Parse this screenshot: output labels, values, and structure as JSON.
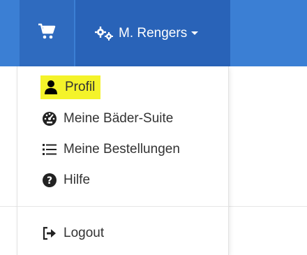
{
  "navbar": {
    "cart_icon": "shopping-cart-icon",
    "user_icon": "gears-icon",
    "user_name": "M. Rengers",
    "accent_color": "#3b7fd4"
  },
  "menu": {
    "items": [
      {
        "label": "Profil",
        "icon": "user-icon",
        "highlighted": true
      },
      {
        "label": "Meine Bäder-Suite",
        "icon": "tachometer-icon"
      },
      {
        "label": "Meine Bestellungen",
        "icon": "list-icon"
      },
      {
        "label": "Hilfe",
        "icon": "question-circle-icon"
      }
    ],
    "logout": {
      "label": "Logout",
      "icon": "sign-out-icon"
    }
  }
}
